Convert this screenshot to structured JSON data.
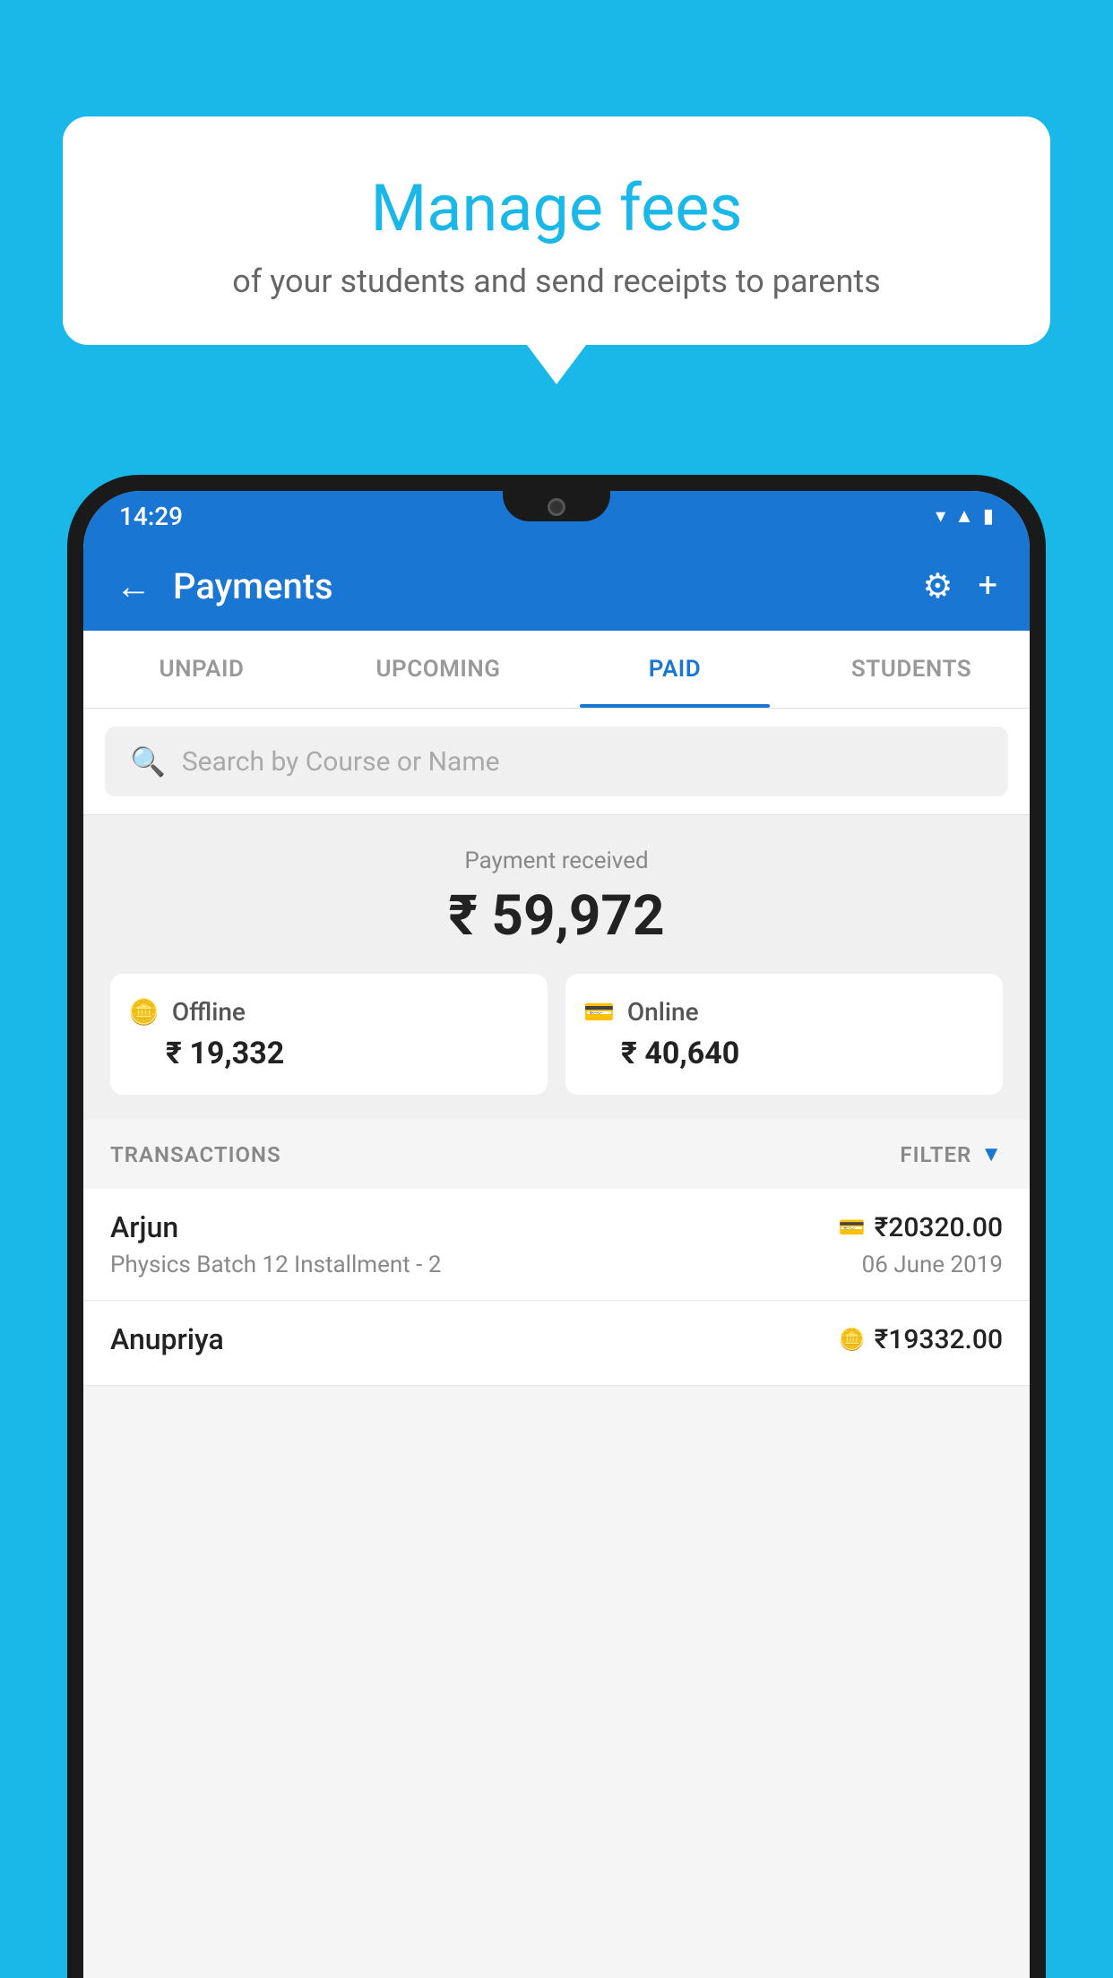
{
  "background_color": "#1ab8e8",
  "speech_bubble": {
    "title": "Manage fees",
    "subtitle": "of your students and send receipts to parents"
  },
  "phone": {
    "status_bar": {
      "time": "14:29",
      "icons": [
        "wifi",
        "signal",
        "battery"
      ]
    },
    "app_bar": {
      "title": "Payments",
      "back_label": "←",
      "settings_label": "⚙",
      "add_label": "+"
    },
    "tabs": [
      {
        "label": "UNPAID",
        "active": false
      },
      {
        "label": "UPCOMING",
        "active": false
      },
      {
        "label": "PAID",
        "active": true
      },
      {
        "label": "STUDENTS",
        "active": false
      }
    ],
    "search": {
      "placeholder": "Search by Course or Name"
    },
    "payment_summary": {
      "label": "Payment received",
      "amount": "₹ 59,972",
      "offline_label": "Offline",
      "offline_amount": "₹ 19,332",
      "online_label": "Online",
      "online_amount": "₹ 40,640"
    },
    "transactions_section": {
      "label": "TRANSACTIONS",
      "filter_label": "FILTER",
      "rows": [
        {
          "name": "Arjun",
          "type_icon": "card",
          "amount": "₹20320.00",
          "course": "Physics Batch 12 Installment - 2",
          "date": "06 June 2019"
        },
        {
          "name": "Anupriya",
          "type_icon": "cash",
          "amount": "₹19332.00",
          "course": "",
          "date": ""
        }
      ]
    }
  }
}
